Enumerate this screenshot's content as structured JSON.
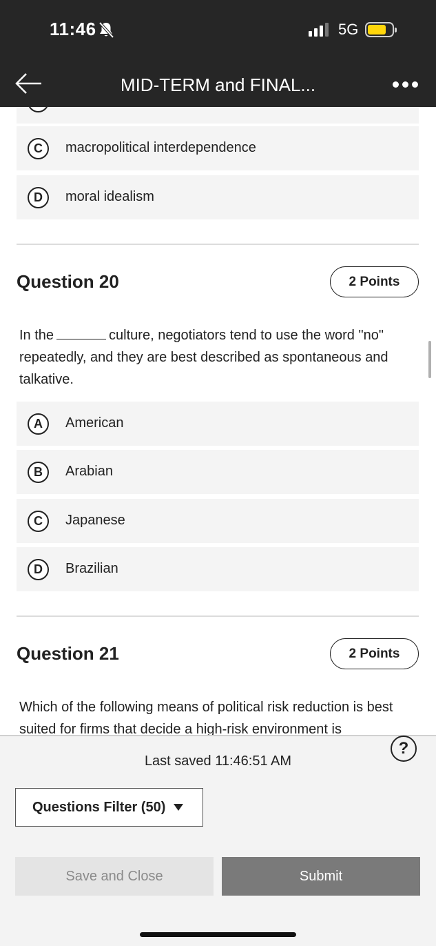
{
  "status_bar": {
    "time": "11:46",
    "network": "5G",
    "icons": [
      "bell-slash-icon",
      "signal-icon",
      "battery-icon"
    ],
    "battery_color": "#ffd60a"
  },
  "header": {
    "title": "MID-TERM and FINAL...",
    "back_icon": "back-arrow-icon",
    "menu_icon": "more-dots-icon"
  },
  "prev_question": {
    "options": [
      {
        "letter": "C",
        "text": "macropolitical interdependence"
      },
      {
        "letter": "D",
        "text": "moral idealism"
      }
    ]
  },
  "questions": [
    {
      "title": "Question 20",
      "points": "2 Points",
      "text_before": "In the",
      "text_after": "culture, negotiators tend to use the word \"no\" repeatedly, and they are best described as spontaneous and talkative.",
      "options": [
        {
          "letter": "A",
          "text": "American"
        },
        {
          "letter": "B",
          "text": "Arabian"
        },
        {
          "letter": "C",
          "text": "Japanese"
        },
        {
          "letter": "D",
          "text": "Brazilian"
        }
      ]
    },
    {
      "title": "Question 21",
      "points": "2 Points",
      "text": "Which of the following means of political risk reduction is best suited for firms that decide a high-risk environment is"
    }
  ],
  "footer": {
    "last_saved": "Last saved 11:46:51 AM",
    "filter_label": "Questions Filter (50)",
    "save_label": "Save and Close",
    "submit_label": "Submit",
    "help_icon": "help-icon",
    "help_glyph": "?"
  }
}
